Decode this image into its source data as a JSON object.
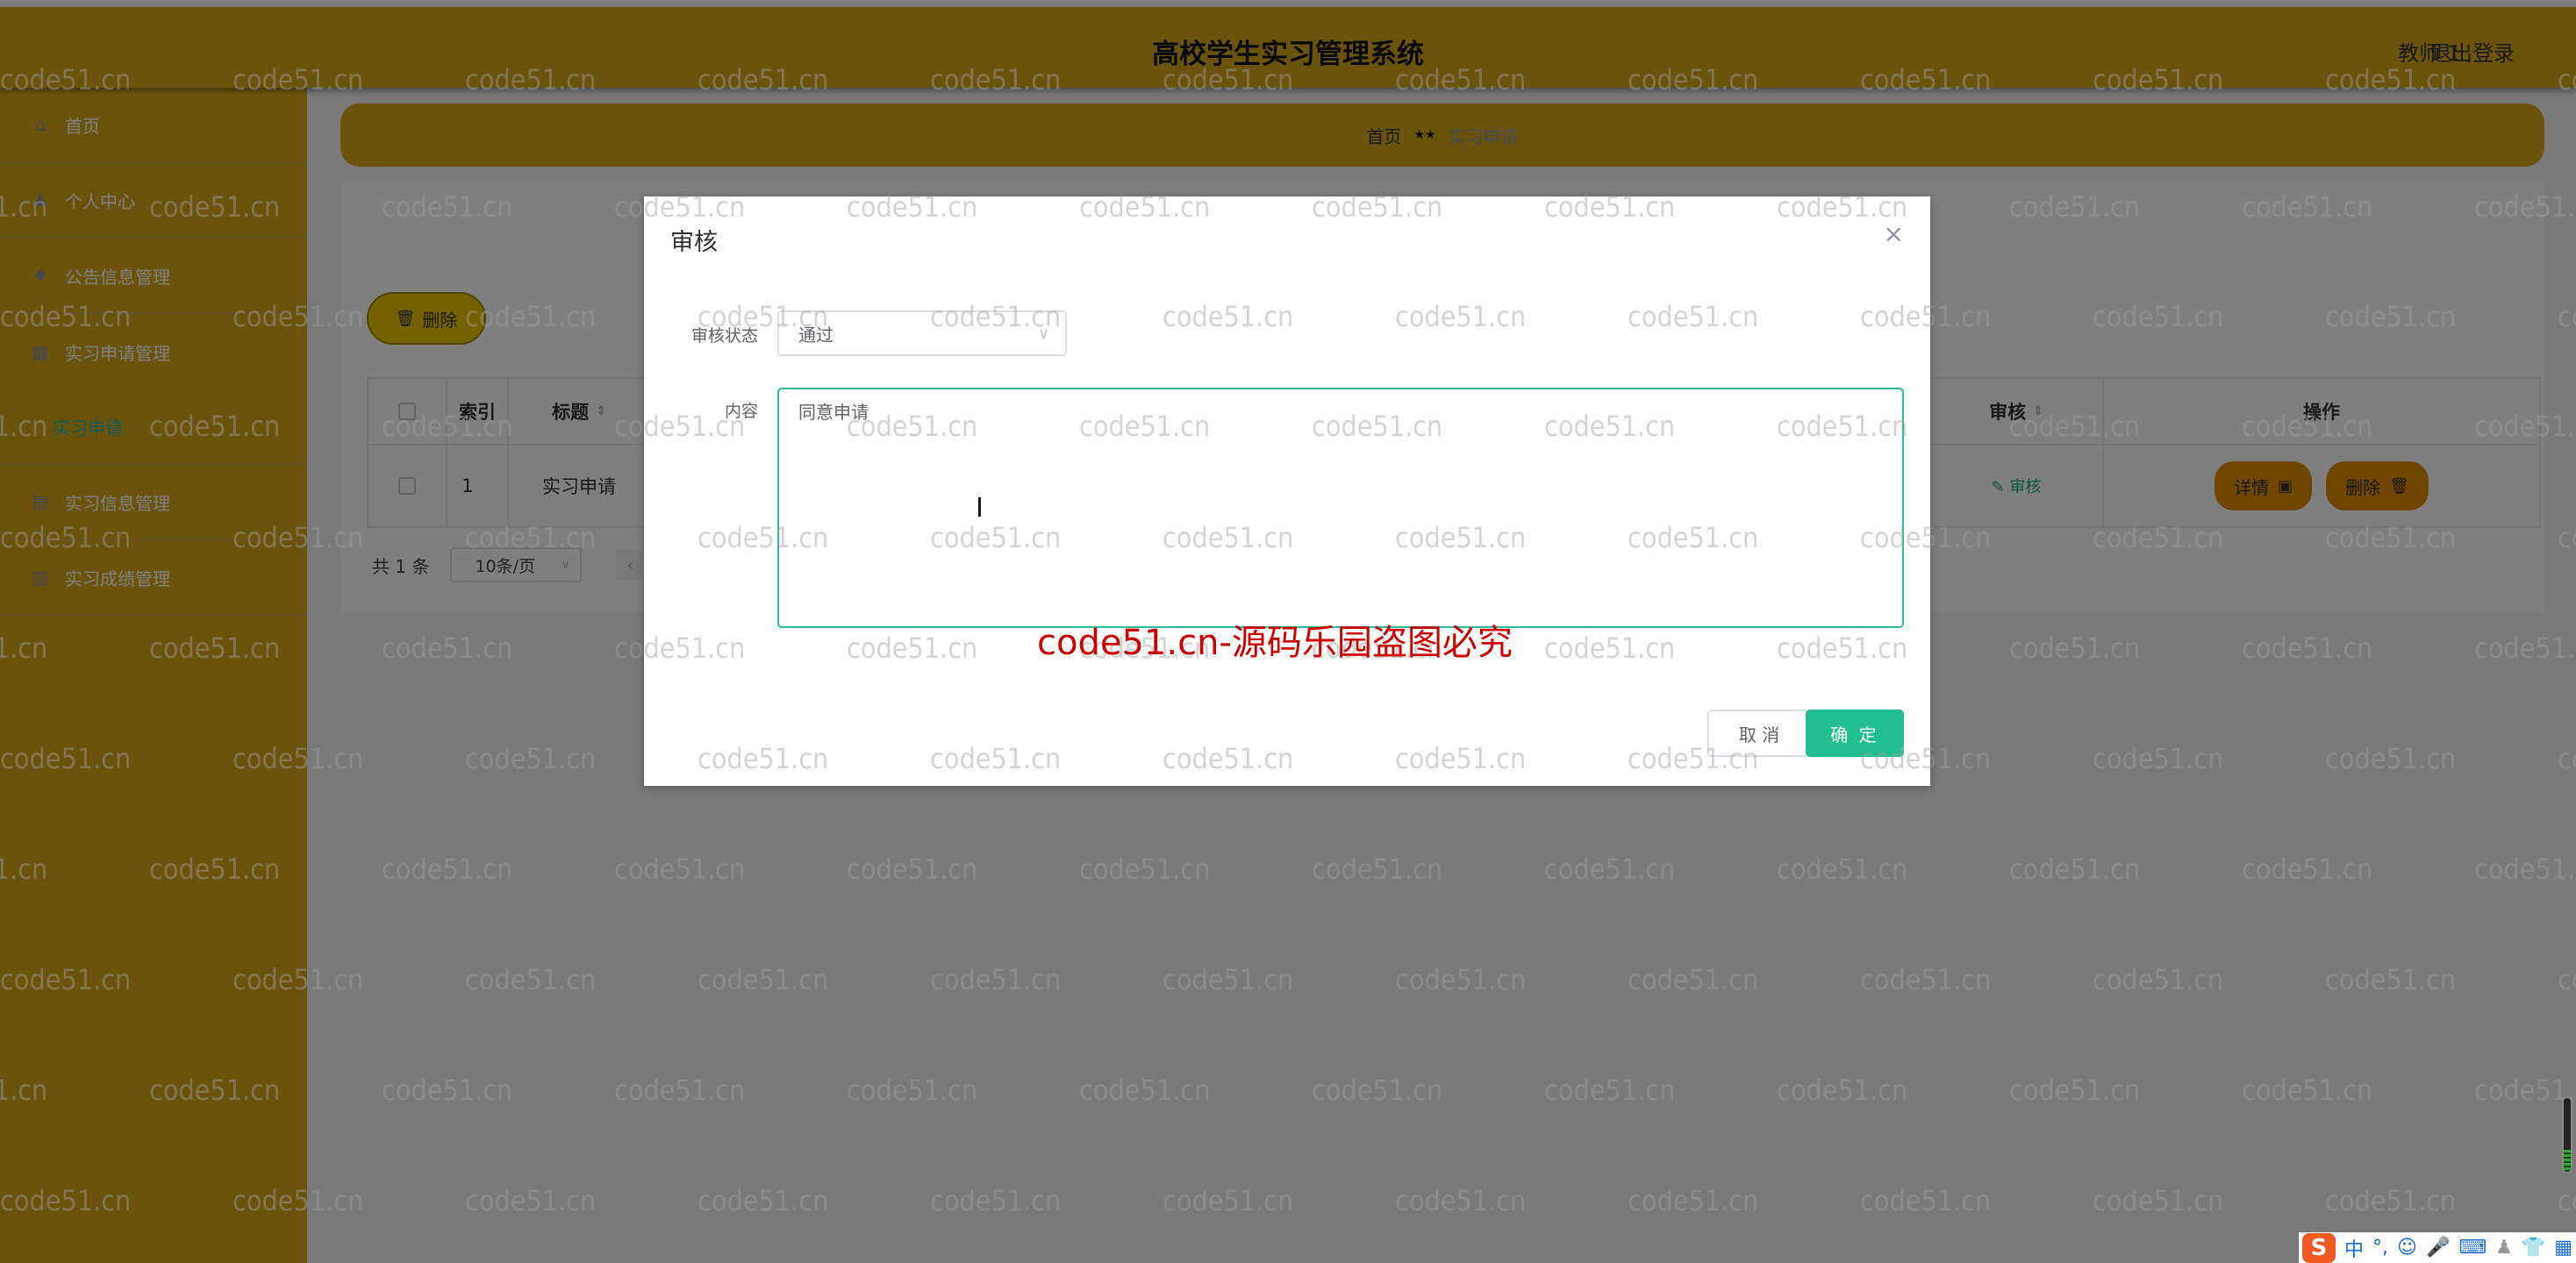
{
  "header": {
    "title": "高校学生实习管理系统",
    "user": "教师 1",
    "logout": "退出登录"
  },
  "sidebar": {
    "items": [
      {
        "label": "首页",
        "icon": "home-icon"
      },
      {
        "label": "个人中心",
        "icon": "user-icon"
      },
      {
        "label": "公告信息管理",
        "icon": "notice-icon"
      },
      {
        "label": "实习申请管理",
        "icon": "grid-icon",
        "children": [
          {
            "label": "实习申请",
            "active": true
          }
        ]
      },
      {
        "label": "实习信息管理",
        "icon": "list-icon"
      },
      {
        "label": "实习成绩管理",
        "icon": "chart-icon"
      }
    ]
  },
  "breadcrumb": {
    "home": "首页",
    "separator": "★★",
    "current": "实习申请"
  },
  "toolbar": {
    "delete_label": "删除",
    "delete_icon": "trash-icon"
  },
  "table": {
    "columns": [
      "",
      "索引",
      "标题",
      "审核",
      "操作"
    ],
    "sortable": {
      "标题": true,
      "审核": true
    },
    "rows": [
      {
        "index": "1",
        "title": "实习申请",
        "audit_link": "审核",
        "detail_btn": "详情",
        "delete_btn": "删除"
      }
    ]
  },
  "pagination": {
    "total": "共 1 条",
    "page_size": "10条/页"
  },
  "dialog": {
    "title": "审核",
    "status_label": "审核状态",
    "status_value": "通过",
    "content_label": "内容",
    "content_value": "同意申请",
    "cancel": "取 消",
    "confirm": "确 定"
  },
  "watermark": {
    "text": "code51.cn",
    "red_text": "code51.cn-源码乐园盗图必究"
  },
  "ime_bar": {
    "logo": "S",
    "mode": "中",
    "punct": "°,",
    "items": [
      "emoji-icon",
      "mic-icon",
      "keyboard-icon",
      "user-icon",
      "skin-icon",
      "apps-icon"
    ]
  },
  "colors": {
    "theme": "#d4a919",
    "accent": "#1fbf8f",
    "operation": "#e08a00",
    "warning_text": "#cc0000"
  }
}
